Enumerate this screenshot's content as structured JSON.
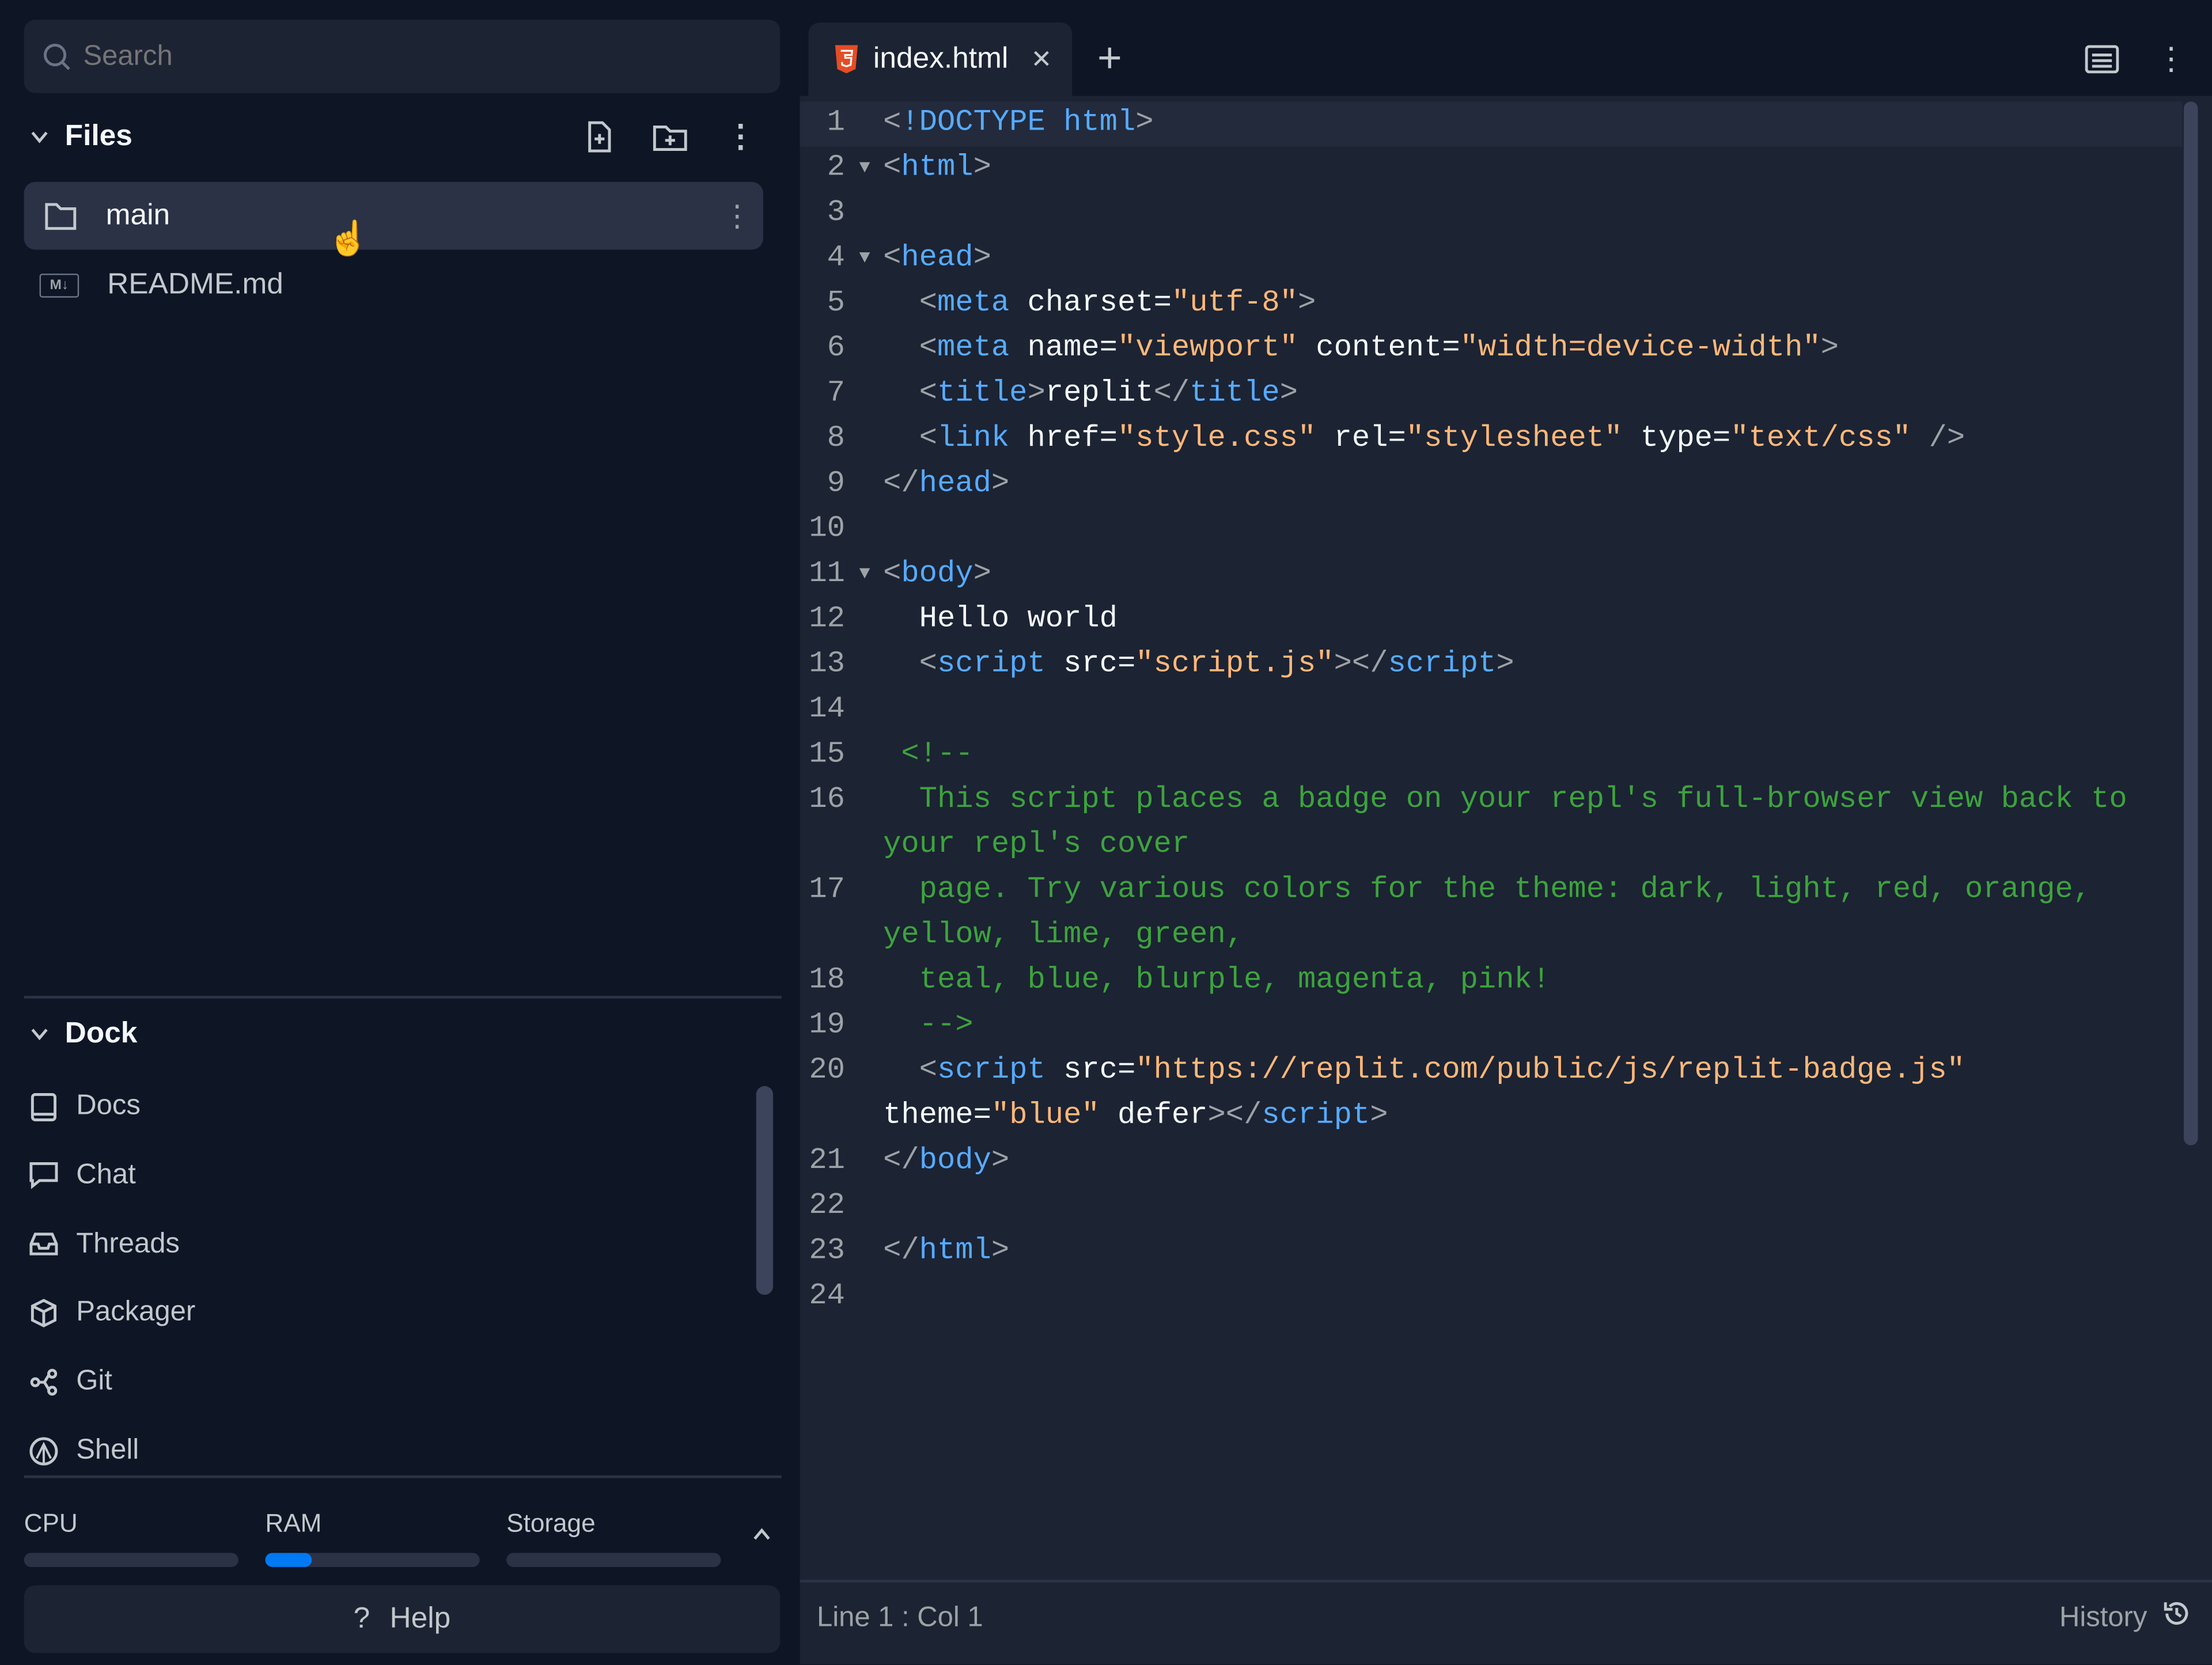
{
  "sidebar": {
    "search_placeholder": "Search",
    "files_title": "Files",
    "files": [
      {
        "name": "main",
        "type": "folder"
      },
      {
        "name": "README.md",
        "type": "markdown"
      }
    ],
    "dock_title": "Dock",
    "dock_items": [
      {
        "label": "Docs",
        "icon": "book-icon"
      },
      {
        "label": "Chat",
        "icon": "chat-icon"
      },
      {
        "label": "Threads",
        "icon": "inbox-icon"
      },
      {
        "label": "Packager",
        "icon": "package-icon"
      },
      {
        "label": "Git",
        "icon": "git-icon"
      },
      {
        "label": "Shell",
        "icon": "shell-icon"
      }
    ],
    "resources": [
      {
        "label": "CPU",
        "usage": 0
      },
      {
        "label": "RAM",
        "usage": 0.22
      },
      {
        "label": "Storage",
        "usage": 0
      }
    ],
    "help_label": "Help",
    "help_icon": "?"
  },
  "editor": {
    "tab_label": "index.html",
    "cursor_position": "Line 1 : Col 1",
    "history_label": "History",
    "lines": [
      {
        "n": "1",
        "fold": false,
        "tokens": [
          [
            "punct",
            "<"
          ],
          [
            "tag",
            "!DOCTYPE html"
          ],
          [
            "punct",
            ">"
          ]
        ]
      },
      {
        "n": "2",
        "fold": true,
        "tokens": [
          [
            "punct",
            "<"
          ],
          [
            "tag",
            "html"
          ],
          [
            "punct",
            ">"
          ]
        ]
      },
      {
        "n": "3",
        "fold": false,
        "tokens": []
      },
      {
        "n": "4",
        "fold": true,
        "tokens": [
          [
            "punct",
            "<"
          ],
          [
            "tag",
            "head"
          ],
          [
            "punct",
            ">"
          ]
        ]
      },
      {
        "n": "5",
        "fold": false,
        "tokens": [
          [
            "text",
            "  "
          ],
          [
            "punct",
            "<"
          ],
          [
            "tag",
            "meta"
          ],
          [
            "attr",
            " charset="
          ],
          [
            "str",
            "\"utf-8\""
          ],
          [
            "punct",
            ">"
          ]
        ]
      },
      {
        "n": "6",
        "fold": false,
        "tokens": [
          [
            "text",
            "  "
          ],
          [
            "punct",
            "<"
          ],
          [
            "tag",
            "meta"
          ],
          [
            "attr",
            " name="
          ],
          [
            "str",
            "\"viewport\""
          ],
          [
            "attr",
            " content="
          ],
          [
            "str",
            "\"width=device-width\""
          ],
          [
            "punct",
            ">"
          ]
        ]
      },
      {
        "n": "7",
        "fold": false,
        "tokens": [
          [
            "text",
            "  "
          ],
          [
            "punct",
            "<"
          ],
          [
            "tag",
            "title"
          ],
          [
            "punct",
            ">"
          ],
          [
            "text",
            "replit"
          ],
          [
            "punct",
            "</"
          ],
          [
            "tag",
            "title"
          ],
          [
            "punct",
            ">"
          ]
        ]
      },
      {
        "n": "8",
        "fold": false,
        "tokens": [
          [
            "text",
            "  "
          ],
          [
            "punct",
            "<"
          ],
          [
            "tag",
            "link"
          ],
          [
            "attr",
            " href="
          ],
          [
            "str",
            "\"style.css\""
          ],
          [
            "attr",
            " rel="
          ],
          [
            "str",
            "\"stylesheet\""
          ],
          [
            "attr",
            " type="
          ],
          [
            "str",
            "\"text/css\""
          ],
          [
            "punct",
            " />"
          ]
        ]
      },
      {
        "n": "9",
        "fold": false,
        "tokens": [
          [
            "punct",
            "</"
          ],
          [
            "tag",
            "head"
          ],
          [
            "punct",
            ">"
          ]
        ]
      },
      {
        "n": "10",
        "fold": false,
        "tokens": []
      },
      {
        "n": "11",
        "fold": true,
        "tokens": [
          [
            "punct",
            "<"
          ],
          [
            "tag",
            "body"
          ],
          [
            "punct",
            ">"
          ]
        ]
      },
      {
        "n": "12",
        "fold": false,
        "tokens": [
          [
            "text",
            "  Hello world"
          ]
        ]
      },
      {
        "n": "13",
        "fold": false,
        "tokens": [
          [
            "text",
            "  "
          ],
          [
            "punct",
            "<"
          ],
          [
            "tag",
            "script"
          ],
          [
            "attr",
            " src="
          ],
          [
            "str",
            "\"script.js\""
          ],
          [
            "punct",
            "></"
          ],
          [
            "tag",
            "script"
          ],
          [
            "punct",
            ">"
          ]
        ]
      },
      {
        "n": "14",
        "fold": false,
        "tokens": []
      },
      {
        "n": "15",
        "fold": false,
        "tokens": [
          [
            "comment",
            " <!--"
          ]
        ]
      },
      {
        "n": "16",
        "fold": false,
        "tokens": [
          [
            "comment",
            "  This script places a badge on your repl's full-browser view back to your repl's cover"
          ]
        ]
      },
      {
        "n": "17",
        "fold": false,
        "tokens": [
          [
            "comment",
            "  page. Try various colors for the theme: dark, light, red, orange, yellow, lime, green,"
          ]
        ]
      },
      {
        "n": "18",
        "fold": false,
        "tokens": [
          [
            "comment",
            "  teal, blue, blurple, magenta, pink!"
          ]
        ]
      },
      {
        "n": "19",
        "fold": false,
        "tokens": [
          [
            "comment",
            "  -->"
          ]
        ]
      },
      {
        "n": "20",
        "fold": false,
        "tokens": [
          [
            "text",
            "  "
          ],
          [
            "punct",
            "<"
          ],
          [
            "tag",
            "script"
          ],
          [
            "attr",
            " src="
          ],
          [
            "str",
            "\"https://replit.com/public/js/replit-badge.js\""
          ],
          [
            "attr",
            " theme="
          ],
          [
            "str",
            "\"blue\""
          ],
          [
            "attr",
            " defer"
          ],
          [
            "punct",
            "></"
          ],
          [
            "tag",
            "script"
          ],
          [
            "punct",
            ">"
          ]
        ]
      },
      {
        "n": "21",
        "fold": false,
        "tokens": [
          [
            "punct",
            "</"
          ],
          [
            "tag",
            "body"
          ],
          [
            "punct",
            ">"
          ]
        ]
      },
      {
        "n": "22",
        "fold": false,
        "tokens": []
      },
      {
        "n": "23",
        "fold": false,
        "tokens": [
          [
            "punct",
            "</"
          ],
          [
            "tag",
            "html"
          ],
          [
            "punct",
            ">"
          ]
        ]
      },
      {
        "n": "24",
        "fold": false,
        "tokens": []
      }
    ]
  },
  "colors": {
    "background": "#0e1525",
    "panel": "#1c2333",
    "accent": "#0079f2",
    "tag": "#57abff",
    "string": "#ffb87a",
    "comment": "#3da33d"
  }
}
